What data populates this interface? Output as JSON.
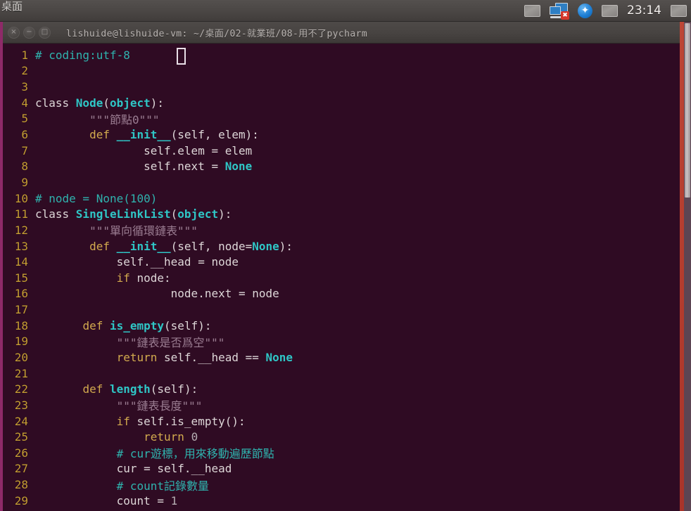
{
  "panel": {
    "app_name": "桌面",
    "clock": "23:14",
    "tray": [
      {
        "name": "indicator-display-icon",
        "glyph": ""
      },
      {
        "name": "network-disconnected-icon",
        "glyph": "✖"
      },
      {
        "name": "bluetooth-icon",
        "glyph": "✦"
      },
      {
        "name": "indicator-session-icon",
        "glyph": ""
      },
      {
        "name": "indicator-power-icon",
        "glyph": ""
      }
    ]
  },
  "window": {
    "title": "lishuide@lishuide-vm: ~/桌面/02-就業班/08-用不了pycharm",
    "controls": {
      "close": "×",
      "minimize": "−",
      "maximize": "□"
    }
  },
  "editor": {
    "cursor_line": 1,
    "lines": [
      {
        "n": "1",
        "tokens": [
          {
            "c": "t-com",
            "t": "# coding:utf-8"
          }
        ]
      },
      {
        "n": "2",
        "tokens": []
      },
      {
        "n": "3",
        "tokens": []
      },
      {
        "n": "4",
        "tokens": [
          {
            "c": "t-plain",
            "t": "class "
          },
          {
            "c": "t-cls",
            "t": "Node"
          },
          {
            "c": "t-punc",
            "t": "("
          },
          {
            "c": "t-cls",
            "t": "object"
          },
          {
            "c": "t-punc",
            "t": "):"
          }
        ]
      },
      {
        "n": "5",
        "tokens": [
          {
            "c": "t-doc",
            "t": "        \"\"\"節點0\"\"\""
          }
        ]
      },
      {
        "n": "6",
        "tokens": [
          {
            "c": "t-plain",
            "t": "        "
          },
          {
            "c": "t-kw",
            "t": "def "
          },
          {
            "c": "t-fn",
            "t": "__init__"
          },
          {
            "c": "t-punc",
            "t": "("
          },
          {
            "c": "t-plain",
            "t": "self, elem"
          },
          {
            "c": "t-punc",
            "t": "):"
          }
        ]
      },
      {
        "n": "7",
        "tokens": [
          {
            "c": "t-plain",
            "t": "                self.elem = elem"
          }
        ]
      },
      {
        "n": "8",
        "tokens": [
          {
            "c": "t-plain",
            "t": "                self.next = "
          },
          {
            "c": "t-const",
            "t": "None"
          }
        ]
      },
      {
        "n": "9",
        "tokens": []
      },
      {
        "n": "10",
        "tokens": [
          {
            "c": "t-com",
            "t": "# node = None(100)"
          }
        ]
      },
      {
        "n": "11",
        "tokens": [
          {
            "c": "t-plain",
            "t": "class "
          },
          {
            "c": "t-cls",
            "t": "SingleLinkList"
          },
          {
            "c": "t-punc",
            "t": "("
          },
          {
            "c": "t-cls",
            "t": "object"
          },
          {
            "c": "t-punc",
            "t": "):"
          }
        ]
      },
      {
        "n": "12",
        "tokens": [
          {
            "c": "t-doc",
            "t": "        \"\"\"單向循環鏈表\"\"\""
          }
        ]
      },
      {
        "n": "13",
        "tokens": [
          {
            "c": "t-plain",
            "t": "        "
          },
          {
            "c": "t-kw",
            "t": "def "
          },
          {
            "c": "t-fn",
            "t": "__init__"
          },
          {
            "c": "t-punc",
            "t": "("
          },
          {
            "c": "t-plain",
            "t": "self, node="
          },
          {
            "c": "t-const",
            "t": "None"
          },
          {
            "c": "t-punc",
            "t": "):"
          }
        ]
      },
      {
        "n": "14",
        "tokens": [
          {
            "c": "t-plain",
            "t": "            self.__head = node"
          }
        ]
      },
      {
        "n": "15",
        "tokens": [
          {
            "c": "t-plain",
            "t": "            "
          },
          {
            "c": "t-kw",
            "t": "if"
          },
          {
            "c": "t-plain",
            "t": " node:"
          }
        ]
      },
      {
        "n": "16",
        "tokens": [
          {
            "c": "t-plain",
            "t": "                    node.next = node"
          }
        ]
      },
      {
        "n": "17",
        "tokens": []
      },
      {
        "n": "18",
        "tokens": [
          {
            "c": "t-plain",
            "t": "       "
          },
          {
            "c": "t-kw",
            "t": "def "
          },
          {
            "c": "t-fn",
            "t": "is_empty"
          },
          {
            "c": "t-punc",
            "t": "("
          },
          {
            "c": "t-plain",
            "t": "self"
          },
          {
            "c": "t-punc",
            "t": "):"
          }
        ]
      },
      {
        "n": "19",
        "tokens": [
          {
            "c": "t-doc",
            "t": "            \"\"\"鏈表是否爲空\"\"\""
          }
        ]
      },
      {
        "n": "20",
        "tokens": [
          {
            "c": "t-plain",
            "t": "            "
          },
          {
            "c": "t-kw",
            "t": "return"
          },
          {
            "c": "t-plain",
            "t": " self.__head == "
          },
          {
            "c": "t-const",
            "t": "None"
          }
        ]
      },
      {
        "n": "21",
        "tokens": []
      },
      {
        "n": "22",
        "tokens": [
          {
            "c": "t-plain",
            "t": "       "
          },
          {
            "c": "t-kw",
            "t": "def "
          },
          {
            "c": "t-fn",
            "t": "length"
          },
          {
            "c": "t-punc",
            "t": "("
          },
          {
            "c": "t-plain",
            "t": "self"
          },
          {
            "c": "t-punc",
            "t": "):"
          }
        ]
      },
      {
        "n": "23",
        "tokens": [
          {
            "c": "t-doc",
            "t": "            \"\"\"鏈表長度\"\"\""
          }
        ]
      },
      {
        "n": "24",
        "tokens": [
          {
            "c": "t-plain",
            "t": "            "
          },
          {
            "c": "t-kw",
            "t": "if"
          },
          {
            "c": "t-plain",
            "t": " self.is_empty():"
          }
        ]
      },
      {
        "n": "25",
        "tokens": [
          {
            "c": "t-plain",
            "t": "                "
          },
          {
            "c": "t-kw",
            "t": "return"
          },
          {
            "c": "t-plain",
            "t": " "
          },
          {
            "c": "t-num",
            "t": "0"
          }
        ]
      },
      {
        "n": "26",
        "tokens": [
          {
            "c": "t-com",
            "t": "            # cur遊標，用來移動遍歷節點"
          }
        ]
      },
      {
        "n": "27",
        "tokens": [
          {
            "c": "t-plain",
            "t": "            cur = self.__head"
          }
        ]
      },
      {
        "n": "28",
        "tokens": [
          {
            "c": "t-com",
            "t": "            # count記錄數量"
          }
        ]
      },
      {
        "n": "29",
        "tokens": [
          {
            "c": "t-plain",
            "t": "            count = "
          },
          {
            "c": "t-num",
            "t": "1"
          }
        ]
      }
    ]
  },
  "colors": {
    "terminal_bg": "#2f0b23",
    "window_border": "#8e2a68",
    "desktop": "#b33a2d",
    "line_number": "#c59d33",
    "comment": "#2fb3ae",
    "keyword": "#d2aa4e",
    "class_name": "#2fc6c6",
    "docstring": "#9b7d92",
    "panel_bg": "#4b4745"
  }
}
